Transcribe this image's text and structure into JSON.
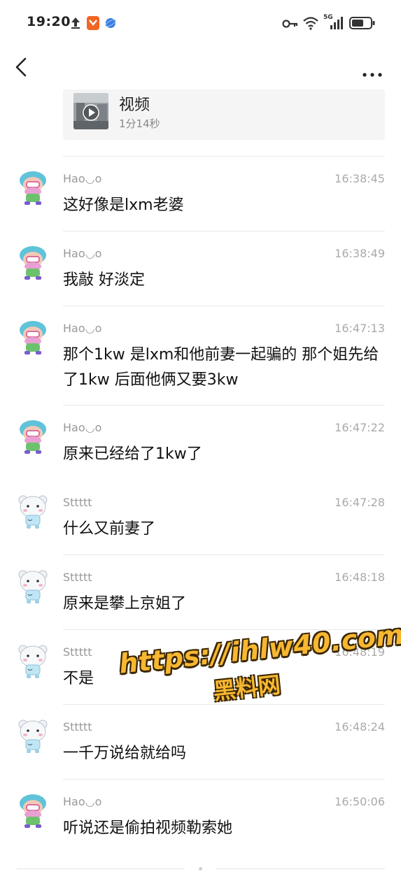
{
  "status_bar": {
    "time": "19:20",
    "icons": [
      "upload-icon",
      "shield-app-icon",
      "browser-app-icon",
      "key-icon",
      "wifi-icon",
      "5g-signal-icon",
      "battery-icon"
    ],
    "network_label": "5G"
  },
  "header": {
    "back_icon": "chevron-left-icon",
    "more_icon": "more-dots-icon"
  },
  "video_card": {
    "title": "视频",
    "duration": "1分14秒"
  },
  "messages": [
    {
      "sender": "Hao◡o",
      "time": "16:38:45",
      "text": "这好像是lxm老婆",
      "avatar": "avatar-blue-hair"
    },
    {
      "sender": "Hao◡o",
      "time": "16:38:49",
      "text": "我敲 好淡定",
      "avatar": "avatar-blue-hair"
    },
    {
      "sender": "Hao◡o",
      "time": "16:47:13",
      "text": "那个1kw 是lxm和他前妻一起骗的 那个姐先给了1kw 后面他俩又要3kw",
      "avatar": "avatar-blue-hair"
    },
    {
      "sender": "Hao◡o",
      "time": "16:47:22",
      "text": "原来已经给了1kw了",
      "avatar": "avatar-blue-hair"
    },
    {
      "sender": "Sttttt",
      "time": "16:47:28",
      "text": "什么又前妻了",
      "avatar": "avatar-bear"
    },
    {
      "sender": "Sttttt",
      "time": "16:48:18",
      "text": "原来是攀上京姐了",
      "avatar": "avatar-bear"
    },
    {
      "sender": "Sttttt",
      "time": "16:48:19",
      "text": "不是",
      "avatar": "avatar-bear"
    },
    {
      "sender": "Sttttt",
      "time": "16:48:24",
      "text": "一千万说给就给吗",
      "avatar": "avatar-bear"
    },
    {
      "sender": "Hao◡o",
      "time": "16:50:06",
      "text": "听说还是偷拍视频勒索她",
      "avatar": "avatar-blue-hair"
    }
  ],
  "watermark": {
    "url": "https://ihlw40.com",
    "name": "黑料网"
  },
  "colors": {
    "text": "#111111",
    "meta": "#999999",
    "divider": "#e9e9e9",
    "card_bg": "#f5f5f5",
    "watermark": "#f7b731"
  }
}
